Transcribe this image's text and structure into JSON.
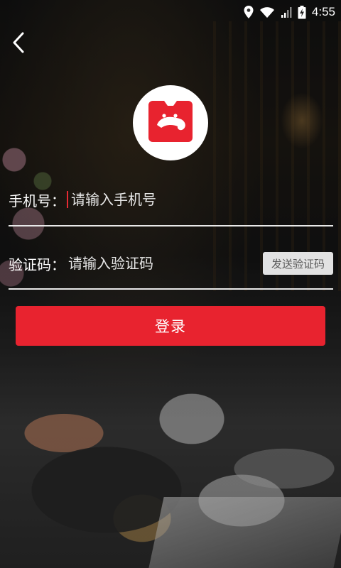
{
  "status_bar": {
    "time": "4:55",
    "icons": [
      "location-icon",
      "wifi-icon",
      "signal-icon",
      "battery-charging-icon"
    ]
  },
  "header": {
    "back_icon": "chevron-left-icon"
  },
  "logo": {
    "icon": "bear-logo-icon",
    "color": "#e8232f"
  },
  "form": {
    "phone": {
      "label": "手机号：",
      "placeholder": "请输入手机号"
    },
    "code": {
      "label": "验证码：",
      "placeholder": "请输入验证码",
      "send_button": "发送验证码"
    },
    "login_button": "登录"
  },
  "colors": {
    "accent": "#e8232f",
    "divider": "#e9e9e9",
    "send_button_bg": "#e2e2e2"
  }
}
